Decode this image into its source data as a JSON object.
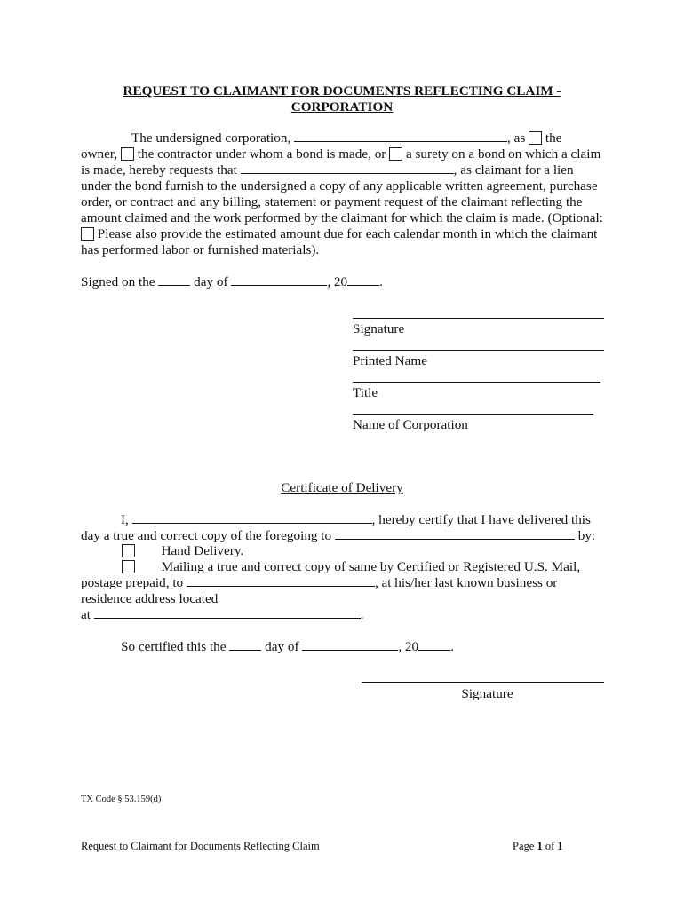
{
  "document": {
    "title_line1": "REQUEST TO CLAIMANT FOR DOCUMENTS REFLECTING CLAIM -",
    "title_line2": "CORPORATION",
    "para1": {
      "l1_a": "The undersigned corporation,",
      "l1_b": ", as",
      "l1_c": "the",
      "l2_a": "owner,",
      "l2_b": "the contractor under whom a bond is made, or",
      "l2_c": "a surety on a bond on which a claim",
      "l3_a": "is made, hereby requests that",
      "l3_b": ", as claimant for a lien",
      "l4": "under the bond furnish to the undersigned a copy of any applicable written agreement, purchase",
      "l5": "order, or contract and any billing, statement or payment request of the claimant reflecting the",
      "l6": "amount claimed and the work performed by the claimant for which the claim is made. (Optional:",
      "l7": "Please also provide the estimated amount due for each calendar month in which the claimant",
      "l8": "has performed labor or furnished materials)."
    },
    "signed": {
      "a": "Signed on the",
      "b": "day of",
      "c": ", 20",
      "d": "."
    },
    "signature_block": {
      "signature": "Signature",
      "printed_name": "Printed Name",
      "title": "Title",
      "corporation": "Name of Corporation"
    },
    "certificate": {
      "heading": "Certificate of Delivery",
      "l1_a": "I,",
      "l1_b": ", hereby certify that I have delivered this",
      "l2_a": "day a true and correct copy of the foregoing to",
      "l2_b": "by:",
      "opt1": "Hand Delivery.",
      "opt2": "Mailing a true and correct copy of same by Certified or Registered U.S. Mail,",
      "l5_a": "postage prepaid, to",
      "l5_b": ", at his/her last known business or",
      "l6": "residence address located",
      "l7_a": "at",
      "l7_b": "."
    },
    "so_certified": {
      "a": "So certified this the",
      "b": "day of",
      "c": ", 20",
      "d": "."
    },
    "cert_signature": "Signature",
    "code_ref": "TX Code § 53.159(d)",
    "footer": {
      "left": "Request to Claimant for Documents Reflecting Claim",
      "page_prefix": "Page ",
      "page_num": "1",
      "page_of": " of ",
      "page_total": "1"
    }
  }
}
